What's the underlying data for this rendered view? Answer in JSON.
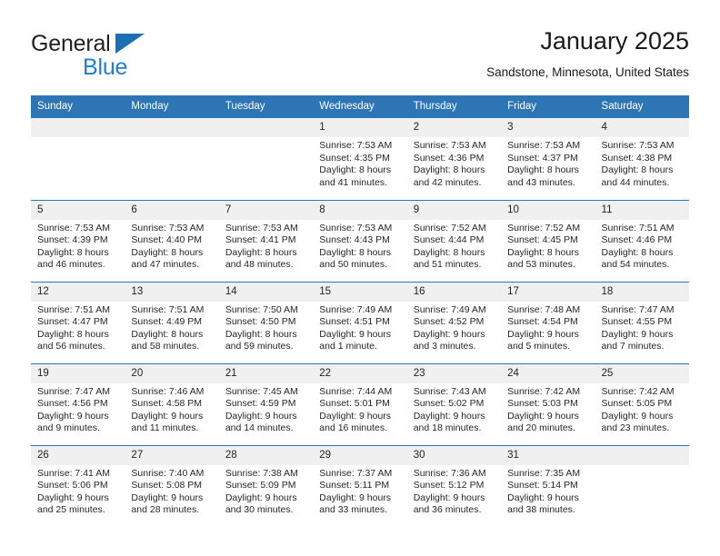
{
  "brand": {
    "name_part1": "General",
    "name_part2": "Blue",
    "accent_color": "#1f7fd0",
    "triangle_color": "#1b6fb3"
  },
  "header": {
    "month_title": "January 2025",
    "location": "Sandstone, Minnesota, United States"
  },
  "calendar": {
    "header_bg": "#2e75b6",
    "daynum_bg": "#f0f0f0",
    "weekday_headers": [
      "Sunday",
      "Monday",
      "Tuesday",
      "Wednesday",
      "Thursday",
      "Friday",
      "Saturday"
    ],
    "labels": {
      "sunrise_prefix": "Sunrise:",
      "sunset_prefix": "Sunset:",
      "daylight_prefix": "Daylight:"
    },
    "weeks": [
      [
        {
          "day": "",
          "line1": "",
          "line2": "",
          "line3": "",
          "line4": ""
        },
        {
          "day": "",
          "line1": "",
          "line2": "",
          "line3": "",
          "line4": ""
        },
        {
          "day": "",
          "line1": "",
          "line2": "",
          "line3": "",
          "line4": ""
        },
        {
          "day": "1",
          "line1": "Sunrise: 7:53 AM",
          "line2": "Sunset: 4:35 PM",
          "line3": "Daylight: 8 hours",
          "line4": "and 41 minutes."
        },
        {
          "day": "2",
          "line1": "Sunrise: 7:53 AM",
          "line2": "Sunset: 4:36 PM",
          "line3": "Daylight: 8 hours",
          "line4": "and 42 minutes."
        },
        {
          "day": "3",
          "line1": "Sunrise: 7:53 AM",
          "line2": "Sunset: 4:37 PM",
          "line3": "Daylight: 8 hours",
          "line4": "and 43 minutes."
        },
        {
          "day": "4",
          "line1": "Sunrise: 7:53 AM",
          "line2": "Sunset: 4:38 PM",
          "line3": "Daylight: 8 hours",
          "line4": "and 44 minutes."
        }
      ],
      [
        {
          "day": "5",
          "line1": "Sunrise: 7:53 AM",
          "line2": "Sunset: 4:39 PM",
          "line3": "Daylight: 8 hours",
          "line4": "and 46 minutes."
        },
        {
          "day": "6",
          "line1": "Sunrise: 7:53 AM",
          "line2": "Sunset: 4:40 PM",
          "line3": "Daylight: 8 hours",
          "line4": "and 47 minutes."
        },
        {
          "day": "7",
          "line1": "Sunrise: 7:53 AM",
          "line2": "Sunset: 4:41 PM",
          "line3": "Daylight: 8 hours",
          "line4": "and 48 minutes."
        },
        {
          "day": "8",
          "line1": "Sunrise: 7:53 AM",
          "line2": "Sunset: 4:43 PM",
          "line3": "Daylight: 8 hours",
          "line4": "and 50 minutes."
        },
        {
          "day": "9",
          "line1": "Sunrise: 7:52 AM",
          "line2": "Sunset: 4:44 PM",
          "line3": "Daylight: 8 hours",
          "line4": "and 51 minutes."
        },
        {
          "day": "10",
          "line1": "Sunrise: 7:52 AM",
          "line2": "Sunset: 4:45 PM",
          "line3": "Daylight: 8 hours",
          "line4": "and 53 minutes."
        },
        {
          "day": "11",
          "line1": "Sunrise: 7:51 AM",
          "line2": "Sunset: 4:46 PM",
          "line3": "Daylight: 8 hours",
          "line4": "and 54 minutes."
        }
      ],
      [
        {
          "day": "12",
          "line1": "Sunrise: 7:51 AM",
          "line2": "Sunset: 4:47 PM",
          "line3": "Daylight: 8 hours",
          "line4": "and 56 minutes."
        },
        {
          "day": "13",
          "line1": "Sunrise: 7:51 AM",
          "line2": "Sunset: 4:49 PM",
          "line3": "Daylight: 8 hours",
          "line4": "and 58 minutes."
        },
        {
          "day": "14",
          "line1": "Sunrise: 7:50 AM",
          "line2": "Sunset: 4:50 PM",
          "line3": "Daylight: 8 hours",
          "line4": "and 59 minutes."
        },
        {
          "day": "15",
          "line1": "Sunrise: 7:49 AM",
          "line2": "Sunset: 4:51 PM",
          "line3": "Daylight: 9 hours",
          "line4": "and 1 minute."
        },
        {
          "day": "16",
          "line1": "Sunrise: 7:49 AM",
          "line2": "Sunset: 4:52 PM",
          "line3": "Daylight: 9 hours",
          "line4": "and 3 minutes."
        },
        {
          "day": "17",
          "line1": "Sunrise: 7:48 AM",
          "line2": "Sunset: 4:54 PM",
          "line3": "Daylight: 9 hours",
          "line4": "and 5 minutes."
        },
        {
          "day": "18",
          "line1": "Sunrise: 7:47 AM",
          "line2": "Sunset: 4:55 PM",
          "line3": "Daylight: 9 hours",
          "line4": "and 7 minutes."
        }
      ],
      [
        {
          "day": "19",
          "line1": "Sunrise: 7:47 AM",
          "line2": "Sunset: 4:56 PM",
          "line3": "Daylight: 9 hours",
          "line4": "and 9 minutes."
        },
        {
          "day": "20",
          "line1": "Sunrise: 7:46 AM",
          "line2": "Sunset: 4:58 PM",
          "line3": "Daylight: 9 hours",
          "line4": "and 11 minutes."
        },
        {
          "day": "21",
          "line1": "Sunrise: 7:45 AM",
          "line2": "Sunset: 4:59 PM",
          "line3": "Daylight: 9 hours",
          "line4": "and 14 minutes."
        },
        {
          "day": "22",
          "line1": "Sunrise: 7:44 AM",
          "line2": "Sunset: 5:01 PM",
          "line3": "Daylight: 9 hours",
          "line4": "and 16 minutes."
        },
        {
          "day": "23",
          "line1": "Sunrise: 7:43 AM",
          "line2": "Sunset: 5:02 PM",
          "line3": "Daylight: 9 hours",
          "line4": "and 18 minutes."
        },
        {
          "day": "24",
          "line1": "Sunrise: 7:42 AM",
          "line2": "Sunset: 5:03 PM",
          "line3": "Daylight: 9 hours",
          "line4": "and 20 minutes."
        },
        {
          "day": "25",
          "line1": "Sunrise: 7:42 AM",
          "line2": "Sunset: 5:05 PM",
          "line3": "Daylight: 9 hours",
          "line4": "and 23 minutes."
        }
      ],
      [
        {
          "day": "26",
          "line1": "Sunrise: 7:41 AM",
          "line2": "Sunset: 5:06 PM",
          "line3": "Daylight: 9 hours",
          "line4": "and 25 minutes."
        },
        {
          "day": "27",
          "line1": "Sunrise: 7:40 AM",
          "line2": "Sunset: 5:08 PM",
          "line3": "Daylight: 9 hours",
          "line4": "and 28 minutes."
        },
        {
          "day": "28",
          "line1": "Sunrise: 7:38 AM",
          "line2": "Sunset: 5:09 PM",
          "line3": "Daylight: 9 hours",
          "line4": "and 30 minutes."
        },
        {
          "day": "29",
          "line1": "Sunrise: 7:37 AM",
          "line2": "Sunset: 5:11 PM",
          "line3": "Daylight: 9 hours",
          "line4": "and 33 minutes."
        },
        {
          "day": "30",
          "line1": "Sunrise: 7:36 AM",
          "line2": "Sunset: 5:12 PM",
          "line3": "Daylight: 9 hours",
          "line4": "and 36 minutes."
        },
        {
          "day": "31",
          "line1": "Sunrise: 7:35 AM",
          "line2": "Sunset: 5:14 PM",
          "line3": "Daylight: 9 hours",
          "line4": "and 38 minutes."
        },
        {
          "day": "",
          "line1": "",
          "line2": "",
          "line3": "",
          "line4": ""
        }
      ]
    ]
  }
}
